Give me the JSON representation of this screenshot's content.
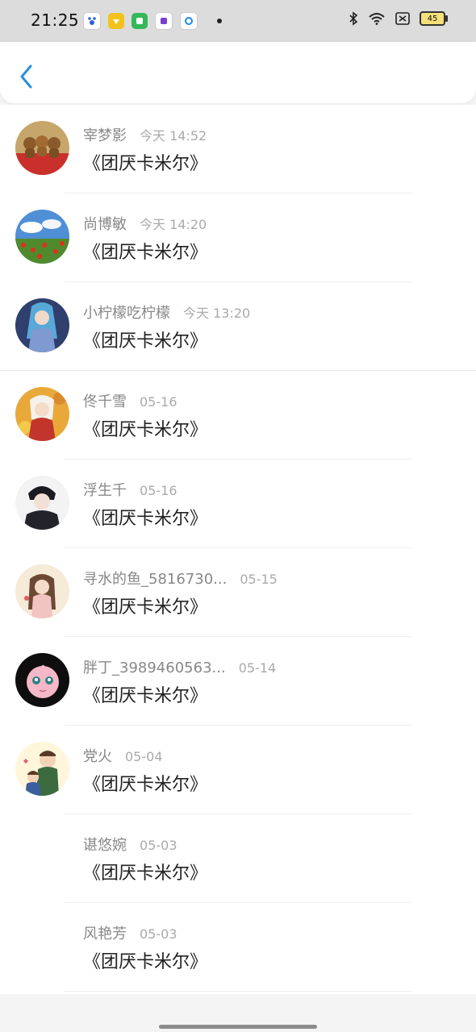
{
  "status_bar": {
    "time": "21:25",
    "battery": "45"
  },
  "header": {
    "back_icon": "chevron-left-icon"
  },
  "list": [
    {
      "name": "宰梦影",
      "time": "今天 14:52",
      "content": "《团厌卡米尔》",
      "avatar": "teddy-bears"
    },
    {
      "name": "尚博敏",
      "time": "今天 14:20",
      "content": "《团厌卡米尔》",
      "avatar": "flower-field"
    },
    {
      "name": "小柠檬吃柠檬",
      "time": "今天 13:20",
      "content": "《团厌卡米尔》",
      "avatar": "anime-blue"
    },
    {
      "name": "佟千雪",
      "time": "05-16",
      "content": "《团厌卡米尔》",
      "avatar": "anime-autumn"
    },
    {
      "name": "浮生千",
      "time": "05-16",
      "content": "《团厌卡米尔》",
      "avatar": "anime-boy"
    },
    {
      "name": "寻水的鱼_5816730...",
      "time": "05-15",
      "content": "《团厌卡米尔》",
      "avatar": "anime-girl"
    },
    {
      "name": "胖丁_3989460563...",
      "time": "05-14",
      "content": "《团厌卡米尔》",
      "avatar": "jigglypuff"
    },
    {
      "name": "党火",
      "time": "05-04",
      "content": "《团厌卡米尔》",
      "avatar": "cartoon-couple"
    },
    {
      "name": "谌悠婉",
      "time": "05-03",
      "content": "《团厌卡米尔》",
      "avatar": "none"
    },
    {
      "name": "风艳芳",
      "time": "05-03",
      "content": "《团厌卡米尔》",
      "avatar": "none"
    }
  ],
  "colors": {
    "accent": "#2a8de0",
    "name_gray": "#888888",
    "time_gray": "#aaaaaa"
  }
}
